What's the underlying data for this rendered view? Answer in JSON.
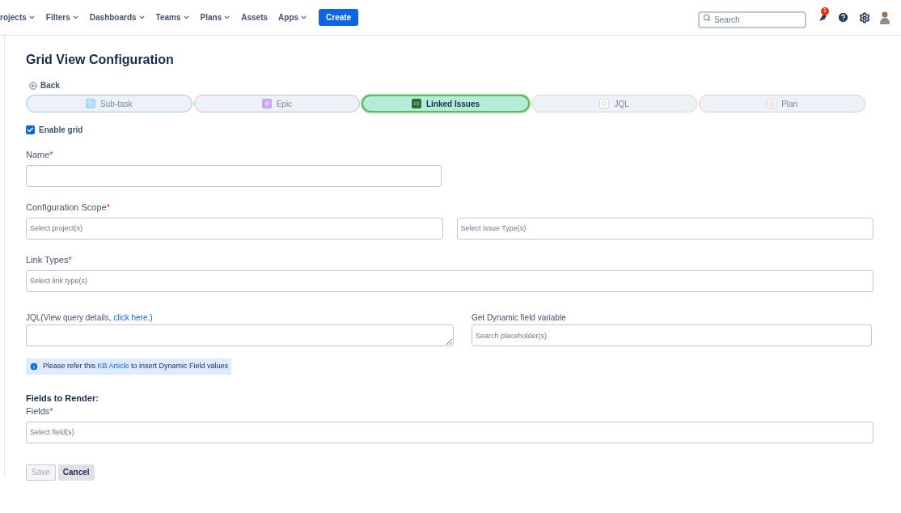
{
  "nav": {
    "items": [
      {
        "label": "rojects",
        "dropdown": true
      },
      {
        "label": "Filters",
        "dropdown": true
      },
      {
        "label": "Dashboards",
        "dropdown": true
      },
      {
        "label": "Teams",
        "dropdown": true
      },
      {
        "label": "Plans",
        "dropdown": true
      },
      {
        "label": "Assets",
        "dropdown": false
      },
      {
        "label": "Apps",
        "dropdown": true
      }
    ],
    "create": "Create",
    "search": {
      "placeholder": "Search"
    },
    "notification_count": "1"
  },
  "title": "Grid View Configuration",
  "back": "Back",
  "tabs": [
    {
      "label": "Sub-task",
      "selected": false,
      "color": "#9ec3e6",
      "kind": "subtask"
    },
    {
      "label": "Epic",
      "selected": false,
      "color": "#e6b3b3",
      "kind": "epic"
    },
    {
      "label": "Linked Issues",
      "selected": true,
      "color": "#5cb85c",
      "kind": "link"
    },
    {
      "label": "JQL",
      "selected": false,
      "color": "#f2cfae",
      "kind": "jql"
    },
    {
      "label": "Plan",
      "selected": false,
      "color": "#f0c4c8",
      "kind": "plan"
    }
  ],
  "enable_grid": {
    "label": "Enable grid",
    "checked": true
  },
  "name": {
    "label": "Name",
    "required_mark": "*"
  },
  "scope": {
    "label": "Configuration Scope",
    "required_mark": "*",
    "placeholders": [
      "Select project(s)",
      "Select issue Type(s)"
    ]
  },
  "link_types": {
    "label": "Link Types",
    "required_mark": "*",
    "placeholder": "Select link type(s)"
  },
  "jql": {
    "label": "JQL(View query details, ",
    "link": "click here.",
    "after": ")"
  },
  "dynamic": {
    "label": "Get Dynamic field variable",
    "placeholder": "Search placeholder(s)"
  },
  "info": {
    "before": "Please refer this ",
    "link": "KB Article",
    "after": " to insert Dynamic Field values"
  },
  "fields_heading": "Fields to Render:",
  "fields": {
    "label": "Fields",
    "required_mark": "*",
    "placeholder": "Select field(s)"
  },
  "buttons": [
    {
      "label": "Save",
      "disabled": true
    },
    {
      "label": "Cancel",
      "disabled": false
    }
  ]
}
